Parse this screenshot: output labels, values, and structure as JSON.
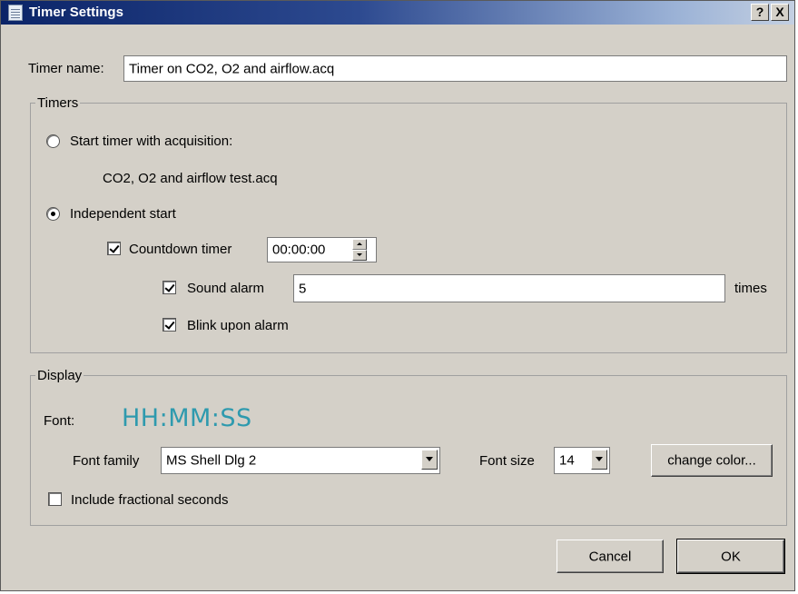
{
  "window": {
    "title": "Timer Settings",
    "help_label": "?",
    "close_label": "X"
  },
  "timer_name": {
    "label": "Timer name:",
    "value": "Timer on CO2, O2 and airflow.acq"
  },
  "timers_group": {
    "title": "Timers",
    "start_with_acquisition": {
      "label": "Start timer with acquisition:",
      "selected": false,
      "file": "CO2, O2 and airflow test.acq"
    },
    "independent_start": {
      "label": "Independent start",
      "selected": true
    },
    "countdown": {
      "label": "Countdown timer",
      "checked": true,
      "value": "00:00:00"
    },
    "sound_alarm": {
      "label": "Sound alarm",
      "checked": true,
      "value": "5",
      "suffix": "times"
    },
    "blink_alarm": {
      "label": "Blink upon alarm",
      "checked": true
    }
  },
  "display_group": {
    "title": "Display",
    "font_label": "Font:",
    "font_preview": "HH:MM:SS",
    "preview_color": "#2e9aae",
    "font_family": {
      "label": "Font family",
      "value": "MS Shell Dlg 2"
    },
    "font_size": {
      "label": "Font size",
      "value": "14"
    },
    "change_color_label": "change color...",
    "fractional_seconds": {
      "label": "Include fractional seconds",
      "checked": false
    }
  },
  "buttons": {
    "cancel": "Cancel",
    "ok": "OK"
  }
}
